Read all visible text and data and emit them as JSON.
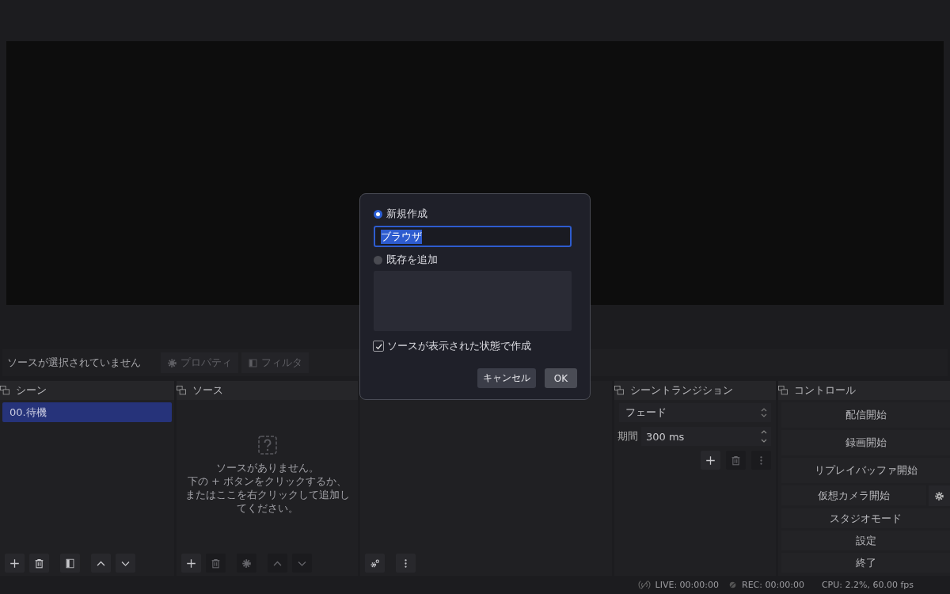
{
  "context_bar": {
    "text": "ソースが選択されていません",
    "buttons": [
      {
        "kind": "properties",
        "label": "プロパティ",
        "disabled": true
      },
      {
        "kind": "filters",
        "label": "フィルタ",
        "disabled": true
      }
    ]
  },
  "scenes": {
    "title": "シーン",
    "items": [
      {
        "label": "00.待機",
        "selected": true
      }
    ],
    "toolbar": [
      {
        "kind": "add",
        "disabled": false
      },
      {
        "kind": "remove",
        "disabled": false
      },
      {
        "kind": "filters",
        "disabled": false
      },
      {
        "kind": "up",
        "disabled": false
      },
      {
        "kind": "down",
        "disabled": false
      }
    ]
  },
  "sources": {
    "title": "ソース",
    "empty_lines": [
      "ソースがありません。",
      "下の + ボタンをクリックするか、",
      "またはここを右クリックして追加してください。"
    ],
    "toolbar": [
      {
        "kind": "add",
        "disabled": false
      },
      {
        "kind": "remove",
        "disabled": true
      },
      {
        "kind": "properties",
        "disabled": true
      },
      {
        "kind": "up",
        "disabled": true
      },
      {
        "kind": "down",
        "disabled": true
      }
    ]
  },
  "mixer": {
    "toolbar": [
      {
        "kind": "advanced",
        "disabled": false
      },
      {
        "kind": "menu",
        "disabled": false
      }
    ]
  },
  "transitions": {
    "title": "シーントランジション",
    "transition": "フェード",
    "duration_label": "期間",
    "duration": "300 ms",
    "toolbar": [
      {
        "kind": "add",
        "disabled": false
      },
      {
        "kind": "remove",
        "disabled": true
      },
      {
        "kind": "menu",
        "disabled": true
      }
    ]
  },
  "controls": {
    "title": "コントロール",
    "buttons": [
      {
        "label": "配信開始",
        "kind": "plain"
      },
      {
        "label": "録画開始",
        "kind": "plain"
      },
      {
        "label": "リプレイバッファ開始",
        "kind": "plain"
      },
      {
        "label": "仮想カメラ開始",
        "kind": "with_settings"
      },
      {
        "label": "スタジオモード",
        "kind": "plain"
      },
      {
        "label": "設定",
        "kind": "plain"
      },
      {
        "label": "終了",
        "kind": "plain"
      }
    ]
  },
  "status_bar": {
    "live": "LIVE: 00:00:00",
    "rec": "REC: 00:00:00",
    "cpu": "CPU: 2.2%, 60.00 fps"
  },
  "dialog": {
    "new_option": {
      "label": "新規作成",
      "selected": true
    },
    "name_value": "ブラウザ",
    "existing_option": {
      "label": "既存を追加",
      "selected": false
    },
    "visible_checkbox": {
      "label": "ソースが表示された状態で作成",
      "checked": true
    },
    "buttons": [
      {
        "label": "キャンセル",
        "kind": "cancel"
      },
      {
        "label": "OK",
        "kind": "ok"
      }
    ]
  }
}
